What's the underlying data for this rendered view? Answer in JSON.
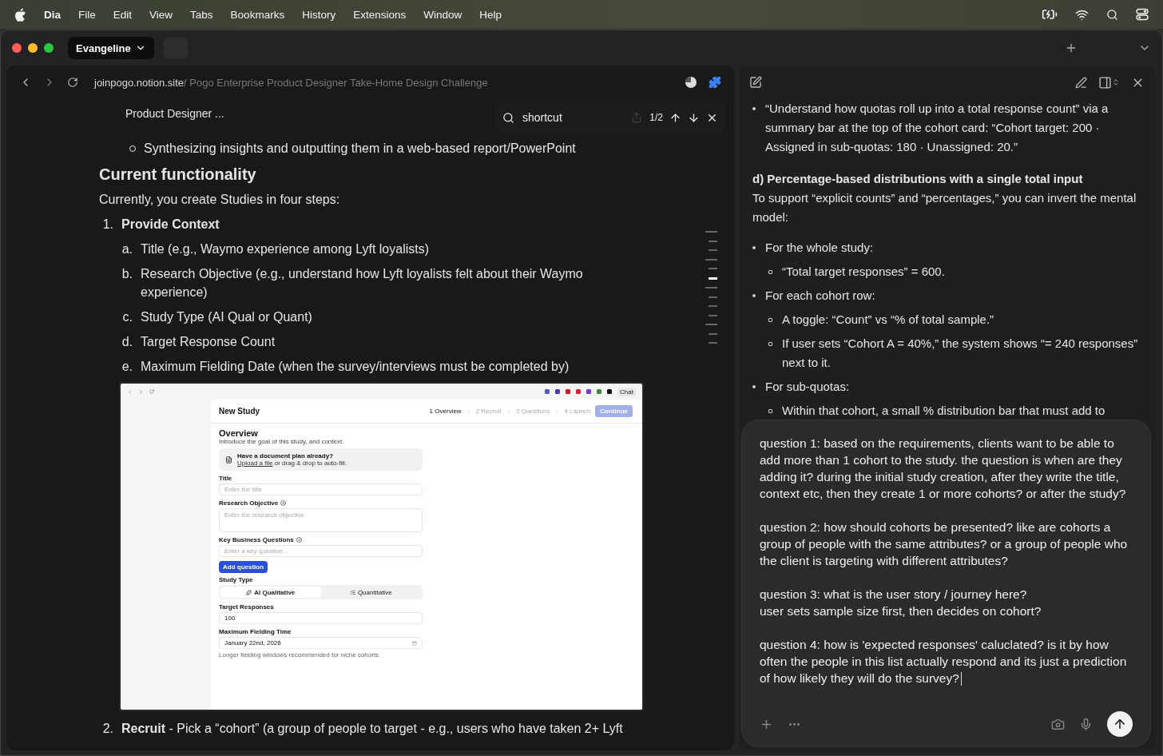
{
  "menubar": {
    "app": "Dia",
    "items": [
      "File",
      "Edit",
      "View",
      "Tabs",
      "Bookmarks",
      "History",
      "Extensions",
      "Window",
      "Help"
    ]
  },
  "window": {
    "profile": "Evangeline"
  },
  "browser": {
    "url_domain": "joinpogo.notion.site",
    "url_path": " / Pogo Enterprise Product Designer Take-Home Design Challenge"
  },
  "find_bar": {
    "query": "shortcut",
    "count": "1/2"
  },
  "page": {
    "sticky_title": "Product Designer ...",
    "top_bullet": "Synthesizing insights and outputting them in a web-based report/PowerPoint",
    "heading": "Current functionality",
    "intro": "Currently, you create Studies in four steps:",
    "steps": [
      {
        "number": "1.",
        "text": "Provide Context",
        "children": [
          {
            "marker": "a.",
            "text": "Title (e.g., Waymo experience among Lyft loyalists)"
          },
          {
            "marker": "b.",
            "text": "Research Objective (e.g., understand how Lyft loyalists felt about their Waymo experience)"
          },
          {
            "marker": "c.",
            "text": "Study Type (AI Qual or Quant)"
          },
          {
            "marker": "d.",
            "text": "Target Response Count"
          },
          {
            "marker": "e.",
            "text": "Maximum Fielding Date (when the survey/interviews must be completed by)"
          }
        ]
      }
    ],
    "screenshot": {
      "chat_label": "Chat",
      "title": "New Study",
      "steps": [
        {
          "number": "1",
          "label": "Overview",
          "selected": true
        },
        {
          "number": "2",
          "label": "Recruit",
          "selected": false
        },
        {
          "number": "3",
          "label": "Questions",
          "selected": false
        },
        {
          "number": "4",
          "label": "Launch",
          "selected": false
        }
      ],
      "continue": {
        "label": "Continue",
        "disabled": true
      },
      "section_title": "Overview",
      "section_subtitle": "Introduce the goal of this study, and context.",
      "upload": {
        "title": "Have a document plan already?",
        "link": "Upload a file",
        "text": " or drag & drop to auto-fill."
      },
      "fields": [
        {
          "kind": "input",
          "label": "Title",
          "placeholder": "Enter the title"
        },
        {
          "kind": "textarea",
          "label": "Research Objective",
          "info": true,
          "placeholder": "Enter the research objective"
        },
        {
          "kind": "input",
          "label": "Key Business Questions",
          "info": true,
          "placeholder": "Enter a key question..."
        },
        {
          "kind": "button",
          "label": "Add question"
        },
        {
          "kind": "segmented",
          "label": "Study Type",
          "options": [
            {
              "label": "AI Qualitative",
              "selected": true
            },
            {
              "label": "Quantitative",
              "selected": false
            }
          ]
        },
        {
          "kind": "input",
          "label": "Target Responses",
          "value": "100"
        },
        {
          "kind": "date",
          "label": "Maximum Fielding Time",
          "value": "January 22nd, 2026",
          "hint": "Longer fielding windows recommended for niche cohorts"
        }
      ]
    },
    "next_step": {
      "number": "2.",
      "text": "**Recruit** - Pick a “cohort”  (a group of people to target - e.g., users who have taken 2+ Lyft"
    }
  },
  "toc": {
    "marks": [
      {
        "kind": "long",
        "selected": false
      },
      {
        "kind": "short",
        "selected": false
      },
      {
        "kind": "short",
        "selected": false
      },
      {
        "kind": "long",
        "selected": false
      },
      {
        "kind": "short",
        "selected": false
      },
      {
        "kind": "short",
        "selected": true
      },
      {
        "kind": "long",
        "selected": false
      },
      {
        "kind": "short",
        "selected": false
      },
      {
        "kind": "short",
        "selected": false
      },
      {
        "kind": "short",
        "selected": false
      },
      {
        "kind": "long",
        "selected": false
      },
      {
        "kind": "short",
        "selected": false
      },
      {
        "kind": "short",
        "selected": false
      }
    ]
  },
  "assistant": {
    "blocks": [
      {
        "kind": "bullets",
        "items": [
          {
            "text": "“Understand how quotas roll up into a total response count” via a summary bar at the top of the cohort card: “Cohort target: 200 · Assigned in sub-quotas: 180 · Unassigned: 20.”"
          }
        ]
      },
      {
        "kind": "heading",
        "text": "d) Percentage-based distributions with a single total input"
      },
      {
        "kind": "paragraph",
        "text": "To support “explicit counts” and “percentages,” you can invert the mental model:"
      },
      {
        "kind": "bullets",
        "items": [
          {
            "text": "For the whole study:",
            "children": [
              "“Total target responses” = 600."
            ]
          },
          {
            "text": "For each cohort row:",
            "children": [
              "A toggle: “Count” vs “% of total sample.”",
              "If user sets “Cohort A = 40%,” the system shows “= 240 responses” next to it."
            ]
          },
          {
            "text": "For sub-quotas:",
            "children": [
              "Within that cohort, a small % distribution bar that must add to"
            ]
          }
        ]
      }
    ]
  },
  "chat_input": {
    "paragraphs": [
      "question 1: based on the requirements, clients want to be able to add more than 1 cohort to the study. the question is when are they adding it? during the initial study creation, after they write the title, context etc, then they create 1 or more cohorts? or after the study?",
      "question 2: how should cohorts be presented? like are cohorts a group of people with the same attributes? or a group of people who the client is targeting with different attributes?",
      "question 3: what is the user story / journey here?\nuser sets sample size first, then decides on cohort?",
      "question 4: how is 'expected responses' caluclated? is it by how often the people in this list actually respond and its just a prediction of how likely they will do the survey?"
    ]
  }
}
